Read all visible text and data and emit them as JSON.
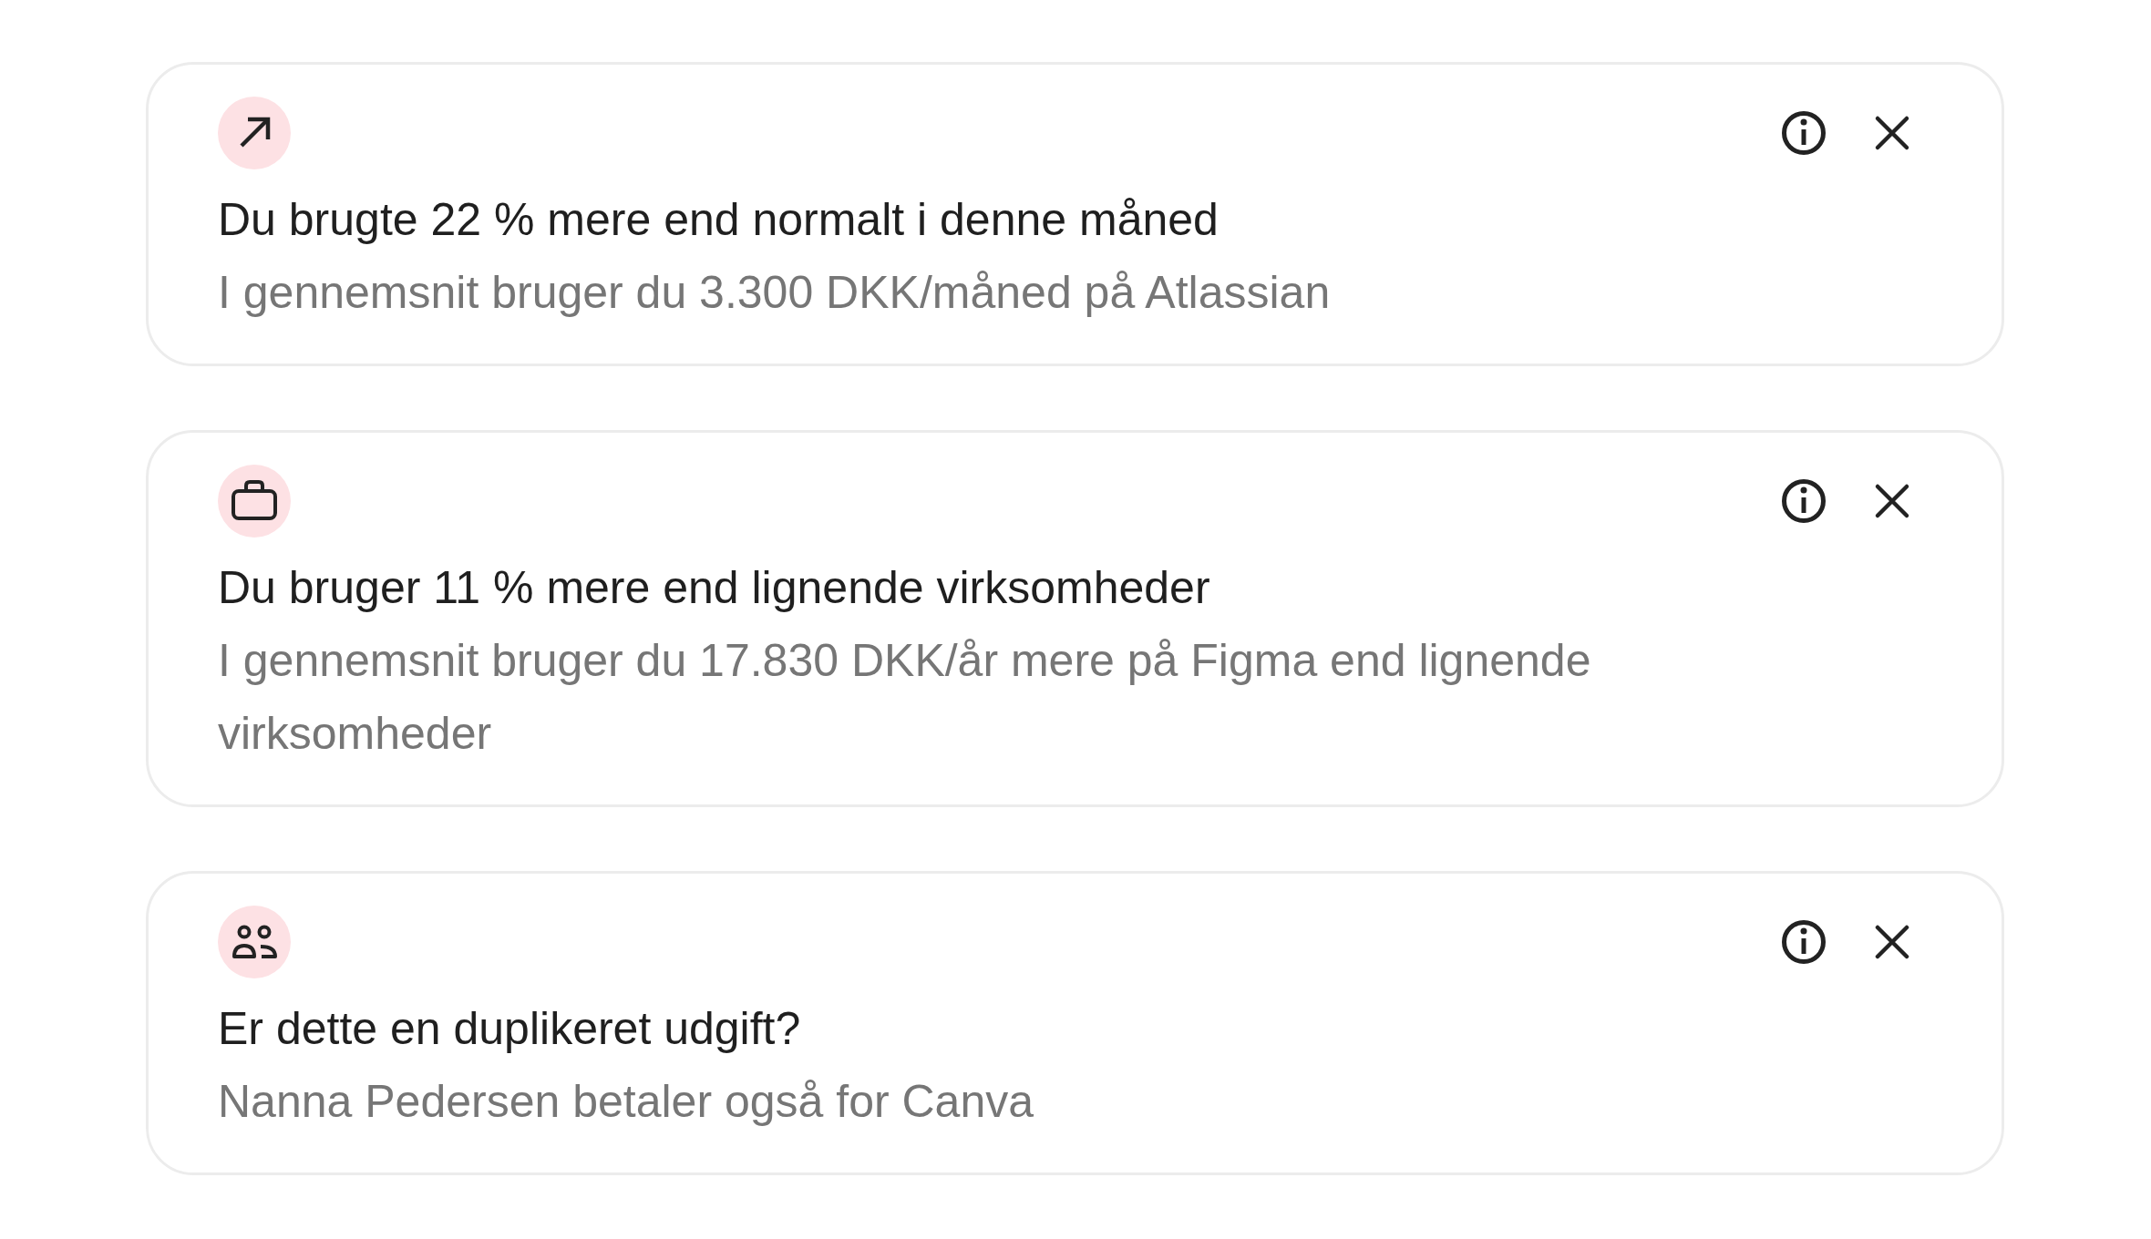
{
  "insights": [
    {
      "kind": "spike",
      "title": "Du brugte 22 % mere end normalt i denne måned",
      "description": "I gennemsnit bruger du 3.300 DKK/måned på Atlassian"
    },
    {
      "kind": "benchmark",
      "title": "Du bruger 11 % mere end lignende virksomheder",
      "description": "I gennemsnit bruger du 17.830 DKK/år mere på Figma end lignende virksomheder"
    },
    {
      "kind": "duplicate",
      "title": "Er dette en duplikeret udgift?",
      "description": "Nanna Pedersen betaler også for Canva"
    }
  ]
}
